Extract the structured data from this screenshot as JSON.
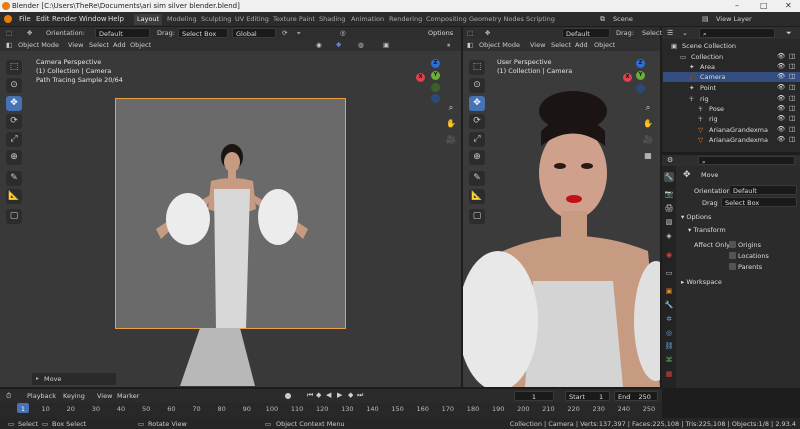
{
  "window": {
    "title": "Blender [C:\\Users\\TheRe\\Documents\\ari sim silver blender.blend]",
    "minimize": "–",
    "maximize": "□",
    "close": "✕"
  },
  "menu": [
    "File",
    "Edit",
    "Render",
    "Window",
    "Help"
  ],
  "workspaces": [
    {
      "label": "Layout",
      "active": true
    },
    {
      "label": "Modeling"
    },
    {
      "label": "Sculpting"
    },
    {
      "label": "UV Editing"
    },
    {
      "label": "Texture Paint"
    },
    {
      "label": "Shading"
    },
    {
      "label": "Animation"
    },
    {
      "label": "Rendering"
    },
    {
      "label": "Compositing"
    },
    {
      "label": "Geometry Nodes"
    },
    {
      "label": "Scripting"
    }
  ],
  "scene": {
    "label": "Scene",
    "view_layer": "View Layer"
  },
  "left_viewport": {
    "header": {
      "orientation_label": "Orientation:",
      "orientation_value": "Default",
      "drag_label": "Drag:",
      "drag_value": "Select Box",
      "transform": "Global",
      "options": "Options",
      "mode": "Object Mode",
      "menus": [
        "View",
        "Select",
        "Add",
        "Object"
      ]
    },
    "overlay": {
      "line1": "Camera Perspective",
      "line2": "(1) Collection | Camera",
      "line3": "Path Tracing Sample 20/64"
    },
    "last_op": "Move"
  },
  "right_viewport": {
    "header": {
      "orientation_value": "Default",
      "drag_label": "Drag:",
      "drag_value": "Select",
      "mode": "Object Mode",
      "menus": [
        "View",
        "Select",
        "Add",
        "Object"
      ]
    },
    "overlay": {
      "line1": "User Perspective",
      "line2": "(1) Collection | Camera"
    }
  },
  "outliner": {
    "rows": [
      {
        "label": "Scene Collection",
        "indent": 0
      },
      {
        "label": "Collection",
        "indent": 1
      },
      {
        "label": "Area",
        "indent": 2
      },
      {
        "label": "Camera",
        "indent": 2,
        "selected": true
      },
      {
        "label": "Point",
        "indent": 2
      },
      {
        "label": "rig",
        "indent": 2
      },
      {
        "label": "Pose",
        "indent": 3
      },
      {
        "label": "rig",
        "indent": 3
      },
      {
        "label": "ArianaGrandexma",
        "indent": 3
      },
      {
        "label": "ArianaGrandexma",
        "indent": 3
      }
    ]
  },
  "properties": {
    "tool_title": "Move",
    "orientation_label": "Orientation",
    "orientation_value": "Default",
    "drag_label": "Drag",
    "drag_value": "Select Box",
    "options_header": "Options",
    "transform_header": "Transform",
    "affect_only_label": "Affect Only",
    "affect_only": [
      "Origins",
      "Locations",
      "Parents"
    ],
    "workspace_header": "Workspace"
  },
  "timeline": {
    "menus": [
      "Playback",
      "Keying",
      "View",
      "Marker"
    ],
    "current_frame": "1",
    "start_label": "Start",
    "start_value": "1",
    "end_label": "End",
    "end_value": "250",
    "ticks": [
      "1",
      "10",
      "20",
      "30",
      "40",
      "50",
      "60",
      "70",
      "80",
      "90",
      "100",
      "110",
      "120",
      "130",
      "140",
      "150",
      "160",
      "170",
      "180",
      "190",
      "200",
      "210",
      "220",
      "230",
      "240",
      "250"
    ]
  },
  "statusbar": {
    "select": "Select",
    "box_select": "Box Select",
    "rotate": "Rotate View",
    "context": "Object Context Menu",
    "stats": "Collection | Camera | Verts:137,397 | Faces:225,108 | Tris:225,108 | Objects:1/8 | 2.93.4"
  },
  "colors": {
    "accent": "#4772b3",
    "camera_frame": "#e8a040",
    "selected_row": "#334d80"
  }
}
